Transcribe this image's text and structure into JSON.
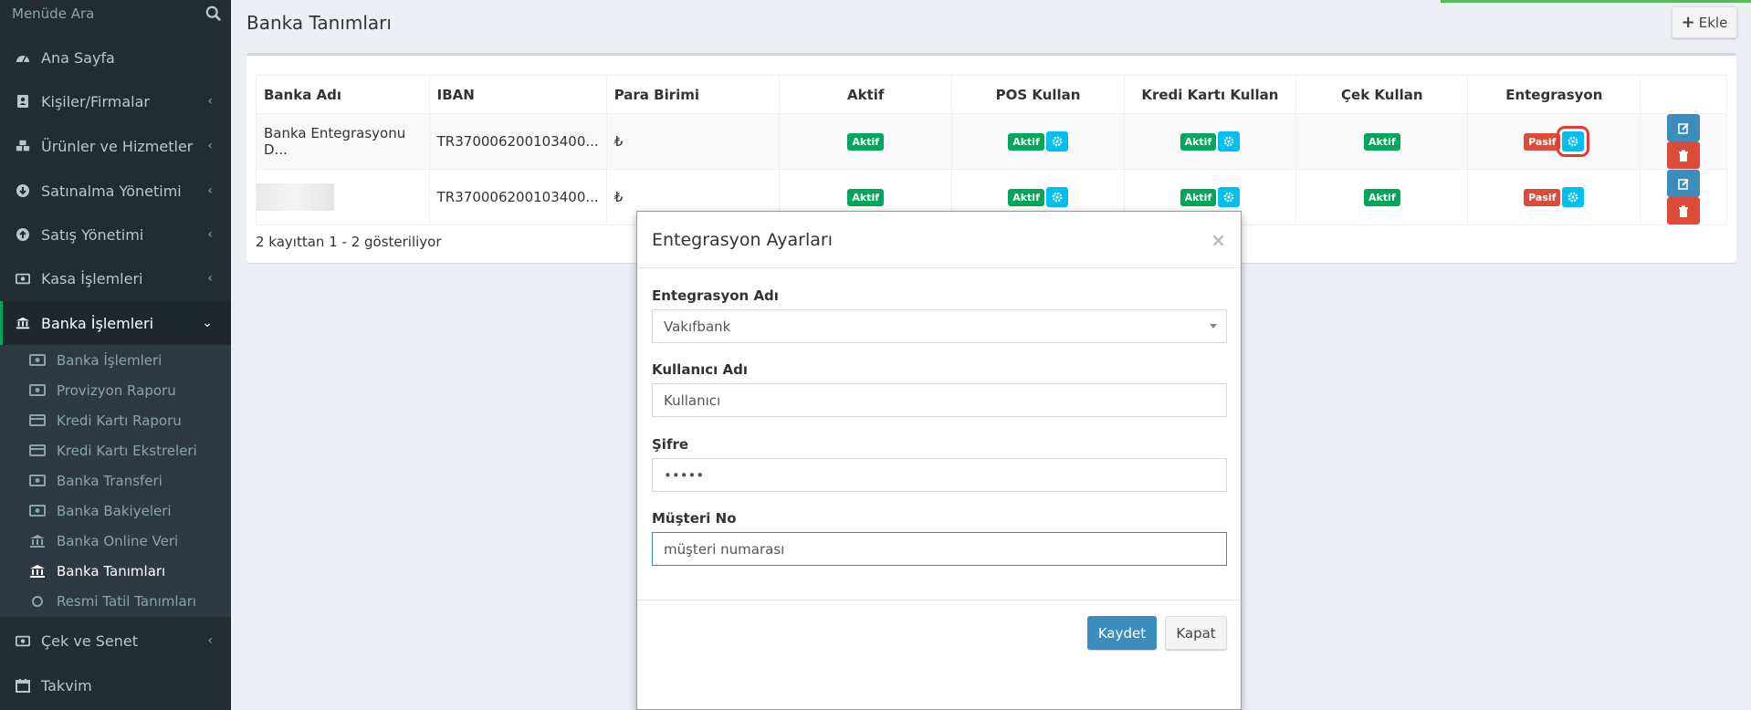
{
  "sidebar": {
    "search_placeholder": "Menüde Ara",
    "items": [
      {
        "label": "Ana Sayfa",
        "icon": "dashboard-icon"
      },
      {
        "label": "Kişiler/Firmalar",
        "icon": "address-book-icon"
      },
      {
        "label": "Ürünler ve Hizmetler",
        "icon": "cubes-icon"
      },
      {
        "label": "Satınalma Yönetimi",
        "icon": "arrow-circle-down-icon"
      },
      {
        "label": "Satış Yönetimi",
        "icon": "arrow-circle-up-icon"
      },
      {
        "label": "Kasa İşlemleri",
        "icon": "money-icon"
      },
      {
        "label": "Banka İşlemleri",
        "icon": "bank-icon"
      },
      {
        "label": "Çek ve Senet",
        "icon": "money-icon"
      },
      {
        "label": "Takvim",
        "icon": "calendar-icon"
      }
    ],
    "submenu": [
      {
        "label": "Banka İşlemleri",
        "icon": "money-icon"
      },
      {
        "label": "Provizyon Raporu",
        "icon": "money-icon"
      },
      {
        "label": "Kredi Kartı Raporu",
        "icon": "credit-card-icon"
      },
      {
        "label": "Kredi Kartı Ekstreleri",
        "icon": "credit-card-icon"
      },
      {
        "label": "Banka Transferi",
        "icon": "money-icon"
      },
      {
        "label": "Banka Bakiyeleri",
        "icon": "money-icon"
      },
      {
        "label": "Banka Online Veri",
        "icon": "bank-icon"
      },
      {
        "label": "Banka Tanımları",
        "icon": "bank-icon"
      },
      {
        "label": "Resmi Tatil Tanımları",
        "icon": "circle-icon"
      }
    ]
  },
  "page": {
    "title": "Banka Tanımları",
    "add_label": "Ekle"
  },
  "table": {
    "headers": [
      "Banka Adı",
      "IBAN",
      "Para Birimi",
      "Aktif",
      "POS Kullan",
      "Kredi Kartı Kullan",
      "Çek Kullan",
      "Entegrasyon"
    ],
    "rows": [
      {
        "bank": "Banka Entegrasyonu D...",
        "iban": "TR370006200103400...",
        "currency": "₺",
        "active": "Aktif",
        "pos": "Aktif",
        "card": "Aktif",
        "cheque": "Aktif",
        "integration": "Pasif"
      },
      {
        "bank": "",
        "iban": "TR370006200103400...",
        "currency": "₺",
        "active": "Aktif",
        "pos": "Aktif",
        "card": "Aktif",
        "cheque": "Aktif",
        "integration": "Pasif"
      }
    ],
    "info": "2 kayıttan 1 - 2 gösteriliyor"
  },
  "modal": {
    "title": "Entegrasyon Ayarları",
    "close_symbol": "×",
    "integration_label": "Entegrasyon Adı",
    "integration_value": "Vakıfbank",
    "username_label": "Kullanıcı Adı",
    "username_value": "Kullanıcı",
    "password_label": "Şifre",
    "password_value": "•••••",
    "customer_label": "Müşteri No",
    "customer_value": "müşteri numarası",
    "save_label": "Kaydet",
    "cancel_label": "Kapat"
  },
  "colors": {
    "sidebar_bg": "#222d32",
    "active_green": "#00a65a",
    "passive_red": "#dd4b39",
    "info_blue": "#00c0ef",
    "primary_blue": "#3c8dbc"
  }
}
